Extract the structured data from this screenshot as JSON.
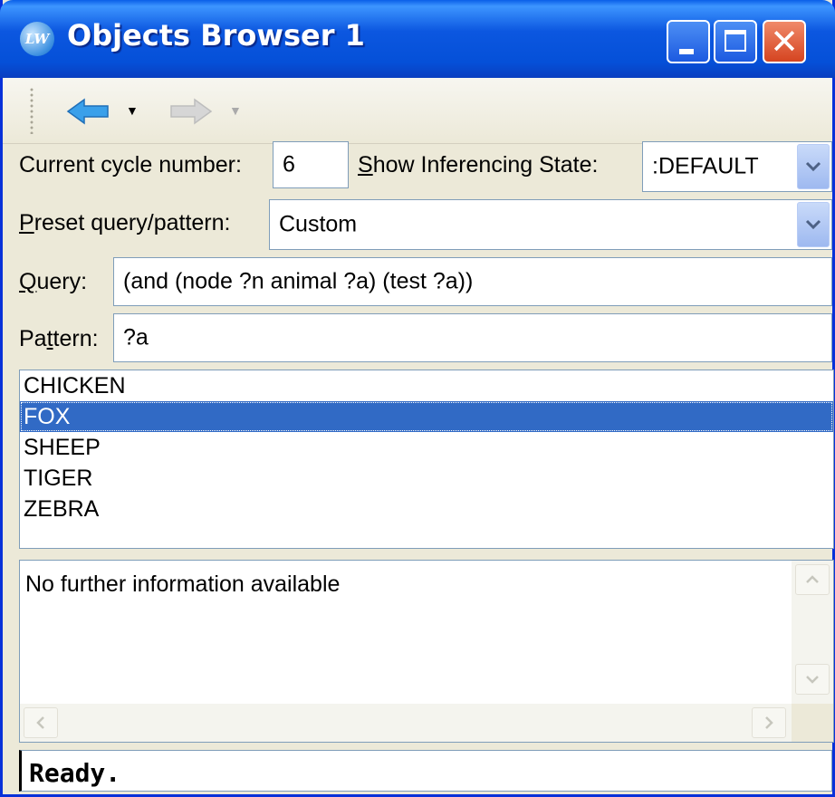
{
  "window": {
    "title": "Objects Browser 1",
    "app_icon_text": "LW"
  },
  "toolbar": {
    "back_icon": "back-arrow-icon",
    "forward_icon": "forward-arrow-icon"
  },
  "controls": {
    "cycle_label": "Current cycle number:",
    "cycle_value": "6",
    "inferencing_label_u": "S",
    "inferencing_label_rest": "how Inferencing State:",
    "inferencing_value": ":DEFAULT",
    "preset_label_u": "P",
    "preset_label_rest": "reset query/pattern:",
    "preset_value": "Custom",
    "query_label_u": "Q",
    "query_label_rest": "uery:",
    "query_value": "(and (node ?n animal ?a) (test ?a))",
    "pattern_label_pre": "Pa",
    "pattern_label_u": "t",
    "pattern_label_rest": "tern:",
    "pattern_value": "?a"
  },
  "results": {
    "items": [
      "CHICKEN",
      "FOX",
      "SHEEP",
      "TIGER",
      "ZEBRA"
    ],
    "selected": "FOX"
  },
  "info": {
    "text": "No further information available"
  },
  "status": {
    "text": "Ready."
  },
  "colors": {
    "title_bar": "#0c57e0",
    "selection": "#316ac5",
    "close_button": "#d54420"
  }
}
